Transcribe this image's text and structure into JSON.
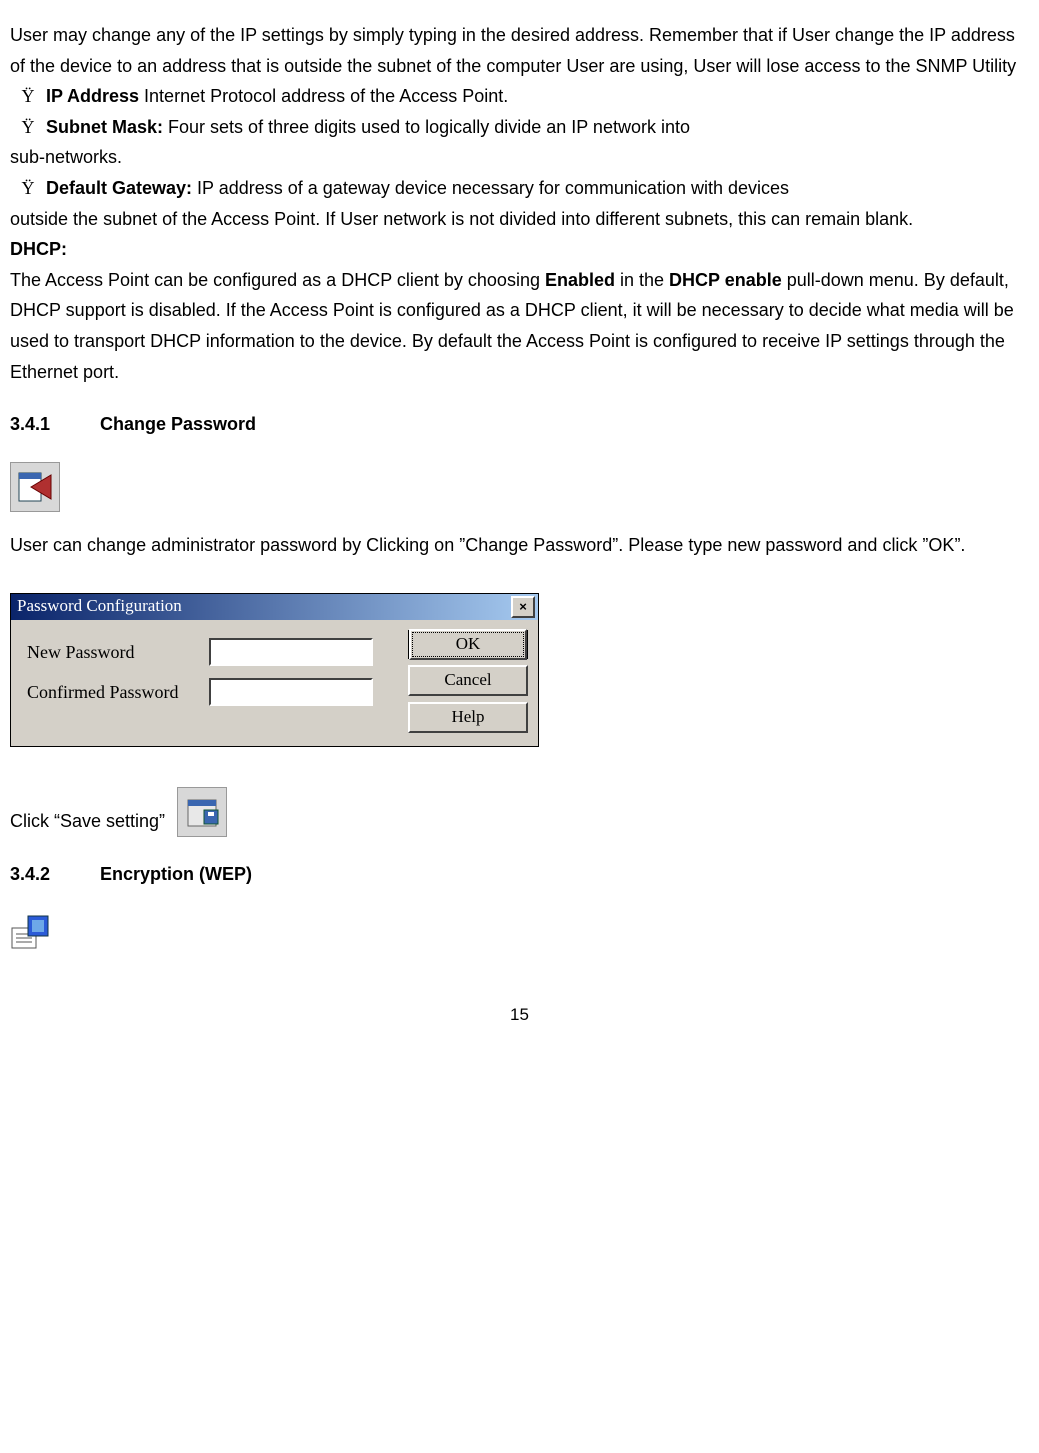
{
  "intro": "User may change any of the IP settings by simply typing in the desired address. Remember that if User change the IP address of the device to an address that is outside the subnet of the computer User are using, User will lose access to the SNMP Utility",
  "bullets": {
    "ip_label": "IP Address",
    "ip_text": " Internet Protocol address of the Access Point.",
    "subnet_label": "Subnet Mask:",
    "subnet_text": " Four sets of three digits used to logically divide an IP network into",
    "subnet_cont": "sub-networks.",
    "gateway_label": "Default Gateway:",
    "gateway_text": " IP address of a gateway device necessary for communication with devices",
    "gateway_cont": "outside the subnet of the Access Point. If User network is not divided into different subnets, this can remain blank."
  },
  "dhcp": {
    "heading": "DHCP:",
    "p1a": "The Access Point can be configured as a DHCP client by choosing ",
    "p1b": "Enabled",
    "p1c": " in the ",
    "p1d": "DHCP enable",
    "p1e": " pull-down menu. By default, DHCP support is disabled. If the Access Point is configured as a DHCP client, it will be necessary to decide what media will be used to transport DHCP information to the device. By default the Access Point is configured to receive IP settings through the Ethernet port."
  },
  "s341": {
    "num": "3.4.1",
    "title": "Change Password",
    "desc": "User can change administrator password by Clicking on ”Change Password”. Please type new password and click ”OK”."
  },
  "dialog": {
    "title": "Password Configuration",
    "new_pw": "New Password",
    "confirm_pw": "Confirmed Password",
    "ok": "OK",
    "cancel": "Cancel",
    "help": "Help",
    "close": "×"
  },
  "save_setting": "Click “Save setting”",
  "s342": {
    "num": "3.4.2",
    "title": "Encryption (WEP)"
  },
  "page_number": "15"
}
